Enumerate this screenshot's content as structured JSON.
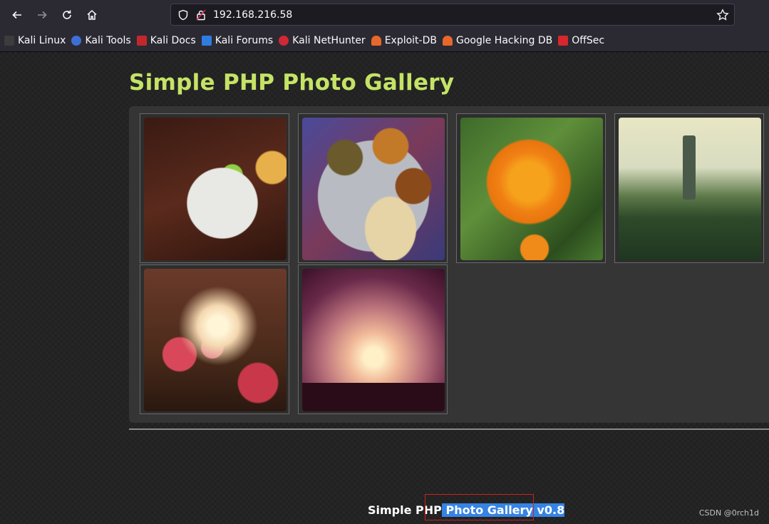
{
  "browser": {
    "url": "192.168.216.58",
    "bookmarks": [
      {
        "label": "Kali Linux",
        "icon": "kali-dragon-icon",
        "color": "#3c3c3c"
      },
      {
        "label": "Kali Tools",
        "icon": "kali-tools-icon",
        "color": "#3d6fd9"
      },
      {
        "label": "Kali Docs",
        "icon": "kali-docs-icon",
        "color": "#c4272b"
      },
      {
        "label": "Kali Forums",
        "icon": "kali-forums-icon",
        "color": "#2f7de1"
      },
      {
        "label": "Kali NetHunter",
        "icon": "nethunter-icon",
        "color": "#d02834"
      },
      {
        "label": "Exploit-DB",
        "icon": "exploit-db-icon",
        "color": "#e8682a"
      },
      {
        "label": "Google Hacking DB",
        "icon": "ghdb-icon",
        "color": "#e8682a"
      },
      {
        "label": "OffSec",
        "icon": "offsec-icon",
        "color": "#d7262d"
      }
    ]
  },
  "page": {
    "title": "Simple PHP Photo Gallery",
    "title_color": "#c5e366",
    "photos": [
      {
        "subject": "breakfast plate with toast, banana and apple"
      },
      {
        "subject": "thali plate with curries and roti"
      },
      {
        "subject": "orange marigold flower"
      },
      {
        "subject": "garden fountain"
      },
      {
        "subject": "pink bougainvillea at sunset"
      },
      {
        "subject": "silhouetted plants against sunset"
      }
    ],
    "footer_plain": "Simple PHP",
    "footer_selected": " Photo Gallery v0.8",
    "watermark": "CSDN @0rch1d"
  }
}
